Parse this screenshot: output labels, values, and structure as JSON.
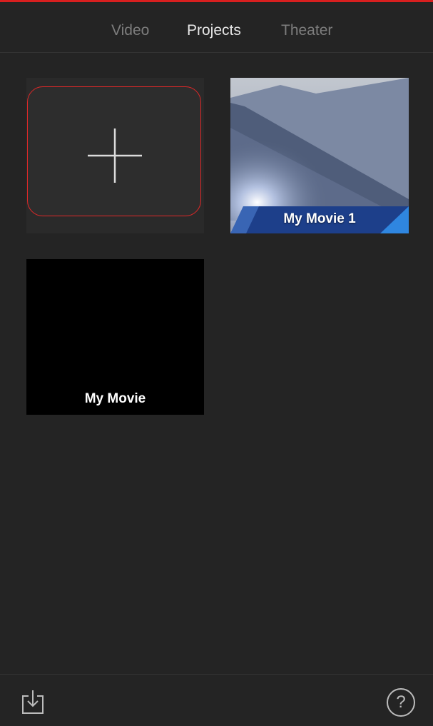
{
  "tabs": [
    {
      "label": "Video",
      "active": false
    },
    {
      "label": "Projects",
      "active": true
    },
    {
      "label": "Theater",
      "active": false
    }
  ],
  "new_project": {
    "icon": "plus-icon"
  },
  "projects": [
    {
      "title": "My Movie 1",
      "thumbnail": "blue-theme-poster"
    },
    {
      "title": "My Movie",
      "thumbnail": "black"
    }
  ],
  "bottom_bar": {
    "import_icon": "import-icon",
    "help_icon": "help-icon",
    "help_glyph": "?"
  },
  "colors": {
    "background": "#242424",
    "accent_red": "#d81f1f",
    "tab_active": "#e6e6e6",
    "tab_inactive": "#7d7d7d"
  }
}
